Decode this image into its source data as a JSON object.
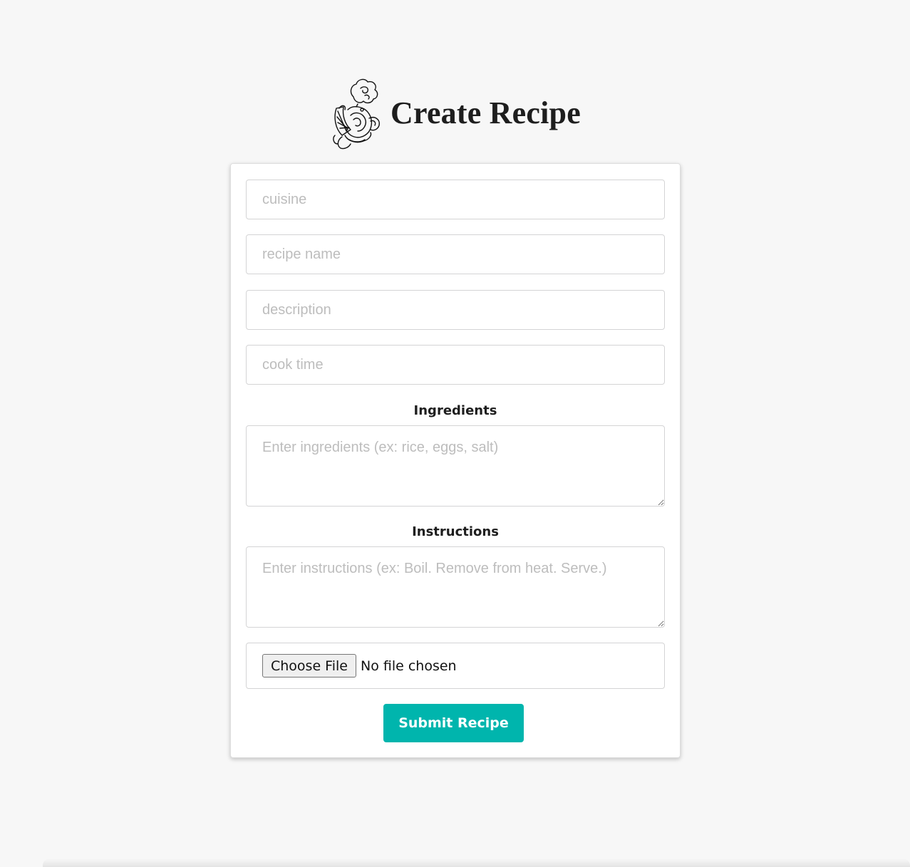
{
  "header": {
    "title": "Create Recipe",
    "logo_icon": "chef-cooking-pot-icon"
  },
  "form": {
    "cuisine_placeholder": "cuisine",
    "recipe_name_placeholder": "recipe name",
    "description_placeholder": "description",
    "cook_time_placeholder": "cook time",
    "ingredients_label": "Ingredients",
    "ingredients_placeholder": "Enter ingredients (ex: rice, eggs, salt)",
    "instructions_label": "Instructions",
    "instructions_placeholder": "Enter instructions (ex: Boil. Remove from heat. Serve.)",
    "file_button_label": "Choose File",
    "file_status": "No file chosen",
    "submit_label": "Submit Recipe"
  },
  "colors": {
    "accent": "#00b5ad",
    "background": "#f7f7f7"
  }
}
